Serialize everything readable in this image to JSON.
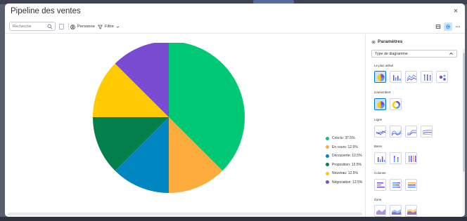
{
  "modal": {
    "title": "Pipeline des ventes",
    "close_label": "×"
  },
  "toolbar": {
    "search_placeholder": "Recherche",
    "person_label": "Personne",
    "filter_label": "Filtre"
  },
  "chart_data": {
    "type": "pie",
    "categories": [
      "Conclu",
      "En cours",
      "Découverte",
      "Proposition",
      "Nouveau",
      "Négociation"
    ],
    "values": [
      37.5,
      12.5,
      12.5,
      12.5,
      12.5,
      12.5
    ],
    "colors": [
      "#00c875",
      "#fdab3d",
      "#0086c0",
      "#037f4c",
      "#ffcb00",
      "#784bd1"
    ],
    "legend": [
      "Conclu: 37.5%",
      "En cours: 12.5%",
      "Découverte: 12.5%",
      "Proposition: 12.5%",
      "Nouveau: 12.5%",
      "Négociation: 12.5%"
    ],
    "legend_position": "right"
  },
  "panel": {
    "title": "Paramètres",
    "chart_type_label": "Type de diagramme",
    "sections": [
      "Le plus utilisé",
      "Camembert",
      "Ligne",
      "Barre",
      "Colonne",
      "Zone"
    ]
  },
  "colors": {
    "accent": "#0073ea",
    "selected_bg": "#cce5ff"
  }
}
